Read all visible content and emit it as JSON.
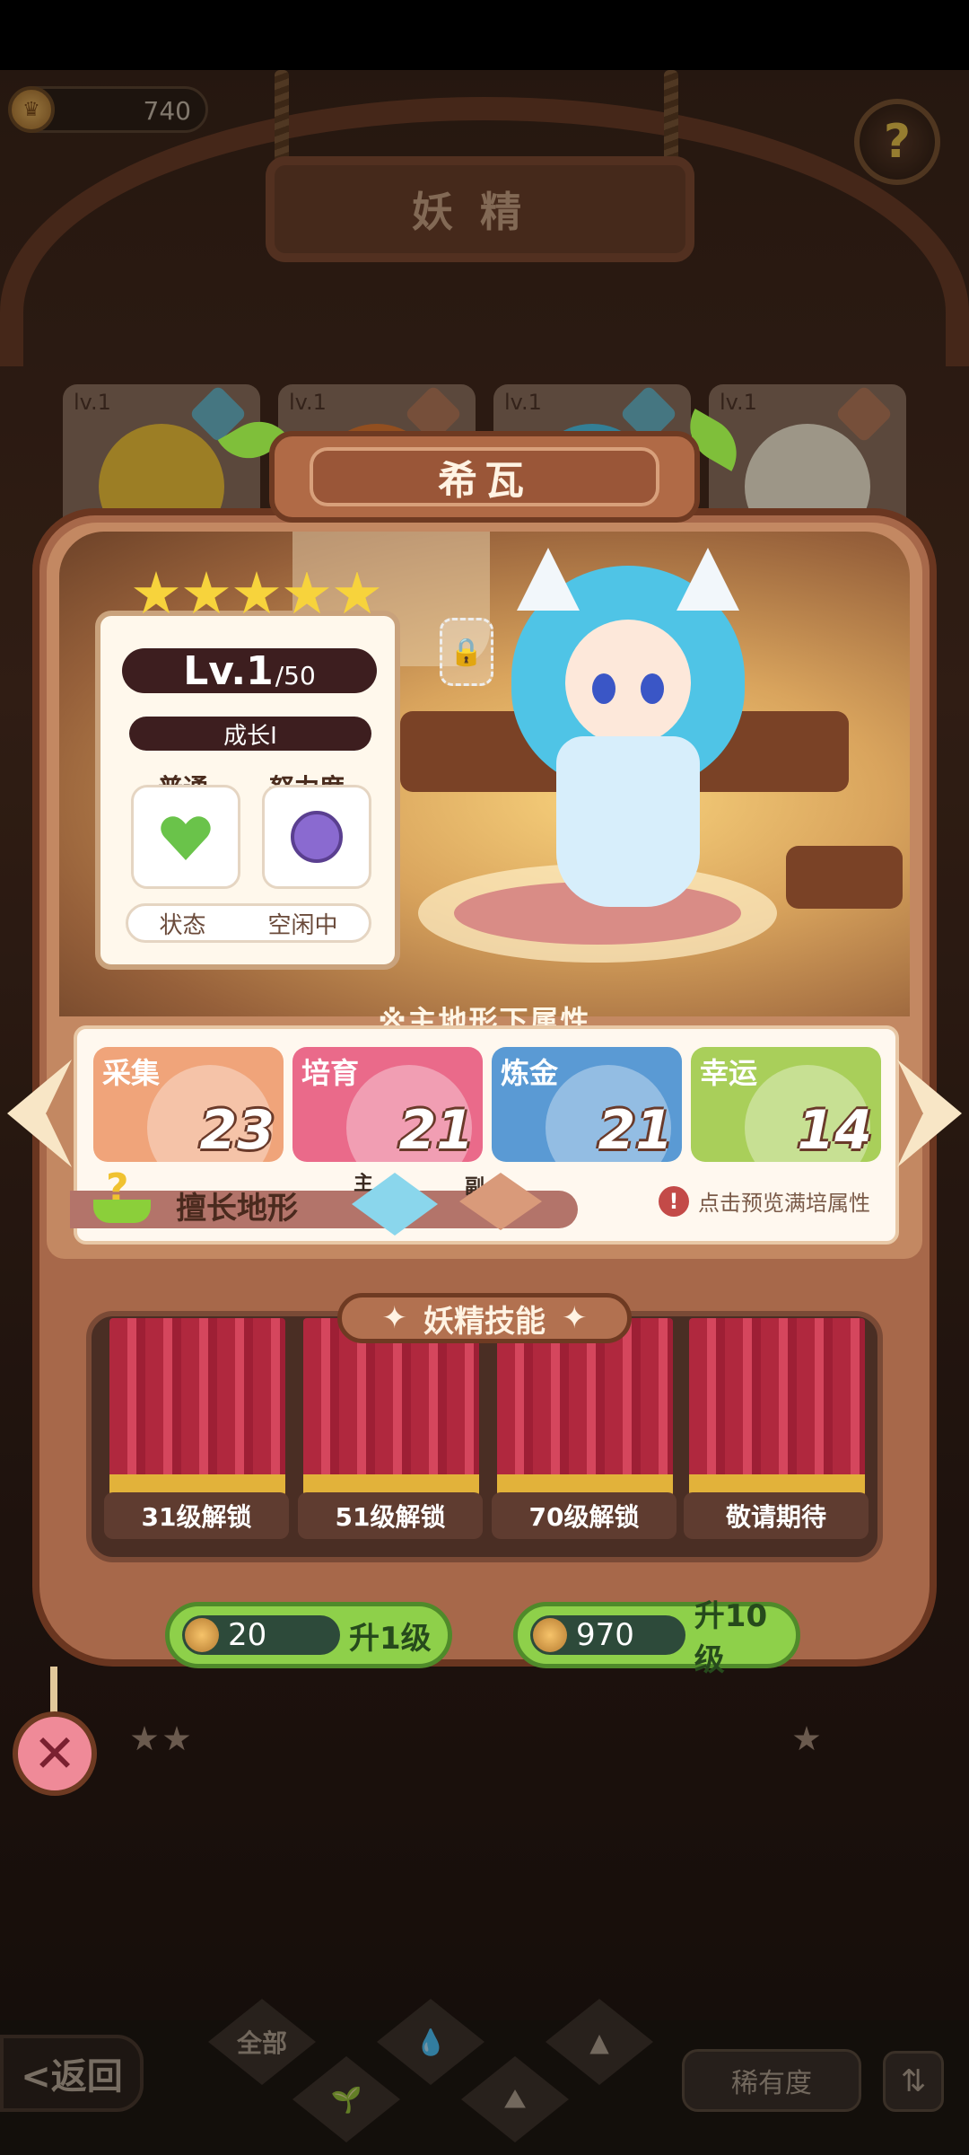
{
  "header": {
    "currency_value": "740",
    "title": "妖精",
    "help_label": "?"
  },
  "background_cards": [
    {
      "level": "lv.1",
      "hair_color": "#f0c23a"
    },
    {
      "level": "lv.1",
      "hair_color": "#e07a32"
    },
    {
      "level": "lv.1",
      "hair_color": "#4fc4e6"
    },
    {
      "level": "lv.1",
      "hair_color": "#f2e6d0"
    }
  ],
  "fairy": {
    "name": "希瓦",
    "stars": 5,
    "level_current": "Lv.1",
    "level_max": "/50",
    "growth": "成长I",
    "normal_label": "普通",
    "effort_label": "努力度",
    "state_label": "状态",
    "state_value": "空闲中"
  },
  "attributes": {
    "title": "※主地形下属性",
    "items": [
      {
        "label": "采集",
        "value": "23",
        "color": "#f0a47a"
      },
      {
        "label": "培育",
        "value": "21",
        "color": "#ea6a8a"
      },
      {
        "label": "炼金",
        "value": "21",
        "color": "#5a9ad4"
      },
      {
        "label": "幸运",
        "value": "14",
        "color": "#a9cf5a"
      }
    ],
    "terrain_label": "擅长地形",
    "terrain_primary_tag": "主",
    "terrain_secondary_tag": "副",
    "preview_text": "点击预览满培属性",
    "warning_glyph": "!"
  },
  "skills": {
    "title": "妖精技能",
    "title_glyph": "✦",
    "slots": [
      {
        "label": "31级解锁"
      },
      {
        "label": "51级解锁"
      },
      {
        "label": "70级解锁"
      },
      {
        "label": "敬请期待"
      }
    ]
  },
  "upgrades": [
    {
      "cost": "20",
      "label": "升1级"
    },
    {
      "cost": "970",
      "label": "升10级"
    }
  ],
  "close_glyph": "✕",
  "bottom_nav": {
    "back_label": "<返回",
    "all_label": "全部",
    "rarity_label": "稀有度",
    "sort_glyph": "⇅"
  },
  "colors": {
    "panel": "#a7684a",
    "upgrade_button": "#8ed04a",
    "curtain": "#b0283e"
  }
}
